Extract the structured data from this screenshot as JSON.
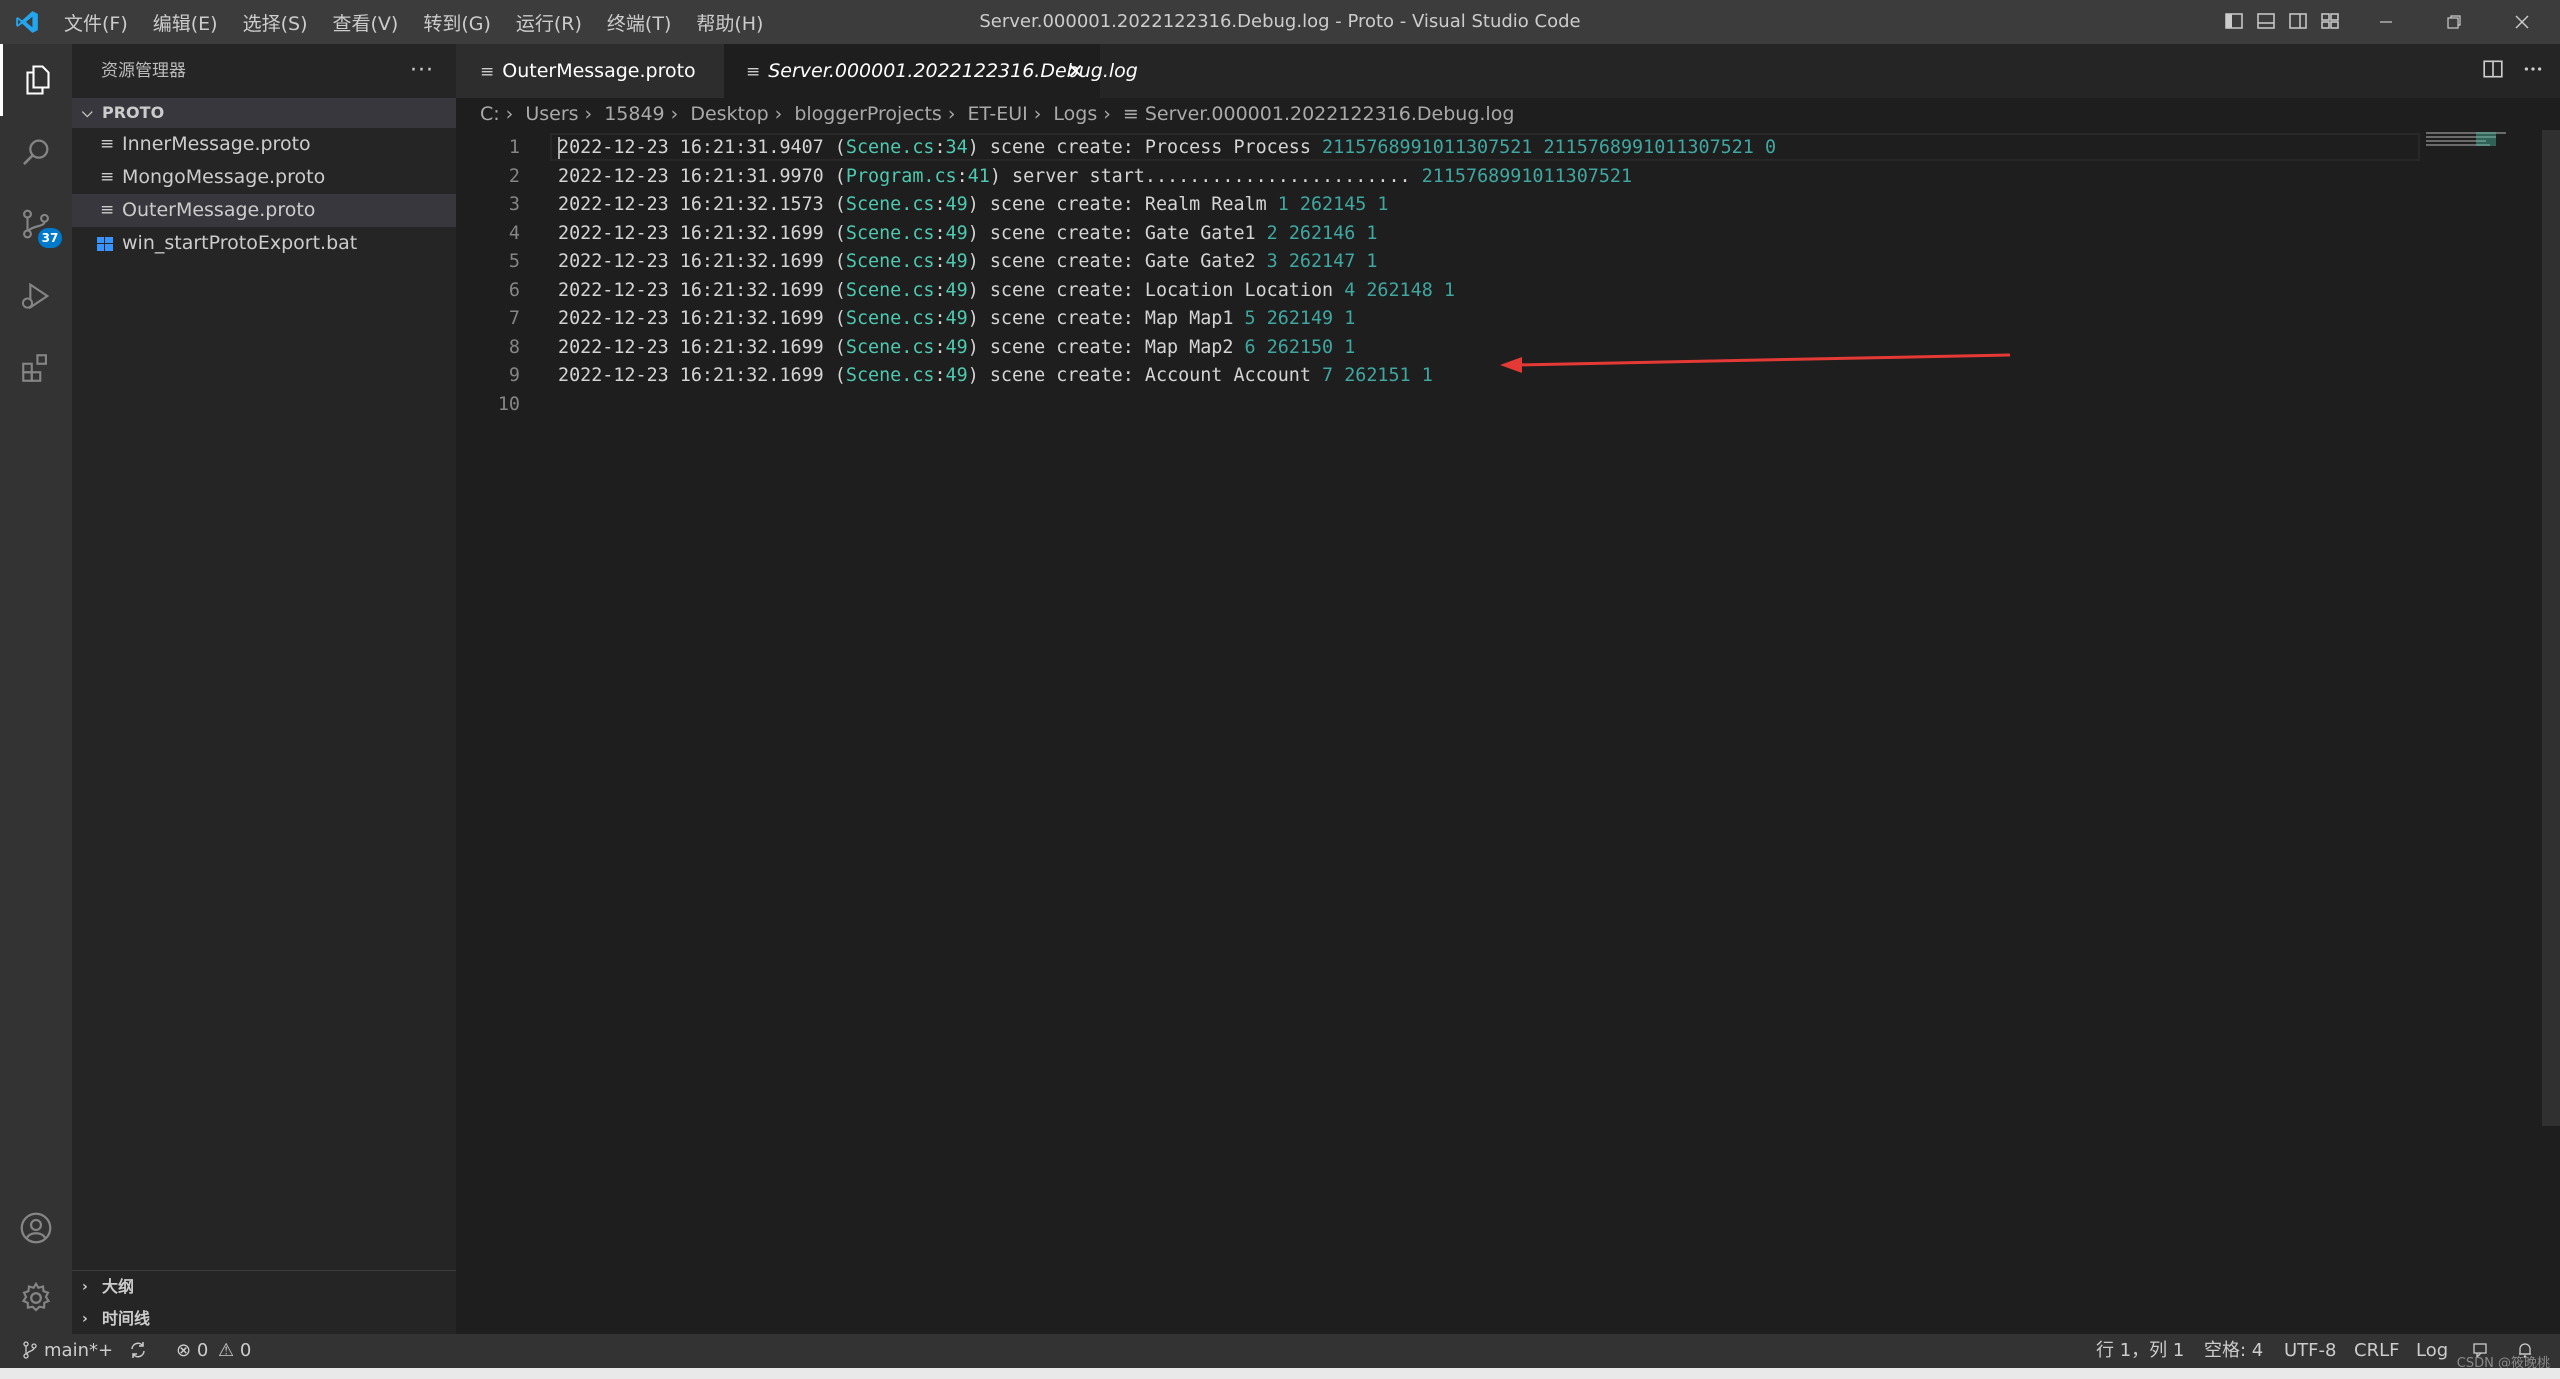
{
  "window": {
    "title": "Server.000001.2022122316.Debug.log - Proto - Visual Studio Code",
    "menu": [
      "文件(F)",
      "编辑(E)",
      "选择(S)",
      "查看(V)",
      "转到(G)",
      "运行(R)",
      "终端(T)",
      "帮助(H)"
    ]
  },
  "activity": {
    "scm_badge": "37"
  },
  "sidebar": {
    "title": "资源管理器",
    "more": "···",
    "folder": "PROTO",
    "files": [
      {
        "name": "InnerMessage.proto"
      },
      {
        "name": "MongoMessage.proto"
      },
      {
        "name": "OuterMessage.proto"
      },
      {
        "name": "win_startProtoExport.bat"
      }
    ],
    "outline": "大纲",
    "timeline": "时间线"
  },
  "tabs": [
    {
      "label": "OuterMessage.proto"
    },
    {
      "label": "Server.000001.2022122316.Debug.log"
    }
  ],
  "breadcrumb": [
    "C:",
    "Users",
    "15849",
    "Desktop",
    "bloggerProjects",
    "ET-EUI",
    "Logs",
    "Server.000001.2022122316.Debug.log"
  ],
  "editor": {
    "lines": [
      {
        "n": "1",
        "ts": "2022-12-23 16:21:31.9407",
        "file": "Scene.cs",
        "ln": "34",
        "msg": "scene create: Process Process",
        "a": "2115768991011307521",
        "b": "2115768991011307521",
        "c": "0"
      },
      {
        "n": "2",
        "ts": "2022-12-23 16:21:31.9970",
        "file": "Program.cs",
        "ln": "41",
        "msg": "server start........................",
        "a": "2115768991011307521",
        "b": "",
        "c": ""
      },
      {
        "n": "3",
        "ts": "2022-12-23 16:21:32.1573",
        "file": "Scene.cs",
        "ln": "49",
        "msg": "scene create: Realm Realm",
        "a": "1",
        "b": "262145",
        "c": "1"
      },
      {
        "n": "4",
        "ts": "2022-12-23 16:21:32.1699",
        "file": "Scene.cs",
        "ln": "49",
        "msg": "scene create: Gate Gate1",
        "a": "2",
        "b": "262146",
        "c": "1"
      },
      {
        "n": "5",
        "ts": "2022-12-23 16:21:32.1699",
        "file": "Scene.cs",
        "ln": "49",
        "msg": "scene create: Gate Gate2",
        "a": "3",
        "b": "262147",
        "c": "1"
      },
      {
        "n": "6",
        "ts": "2022-12-23 16:21:32.1699",
        "file": "Scene.cs",
        "ln": "49",
        "msg": "scene create: Location Location",
        "a": "4",
        "b": "262148",
        "c": "1"
      },
      {
        "n": "7",
        "ts": "2022-12-23 16:21:32.1699",
        "file": "Scene.cs",
        "ln": "49",
        "msg": "scene create: Map Map1",
        "a": "5",
        "b": "262149",
        "c": "1"
      },
      {
        "n": "8",
        "ts": "2022-12-23 16:21:32.1699",
        "file": "Scene.cs",
        "ln": "49",
        "msg": "scene create: Map Map2",
        "a": "6",
        "b": "262150",
        "c": "1"
      },
      {
        "n": "9",
        "ts": "2022-12-23 16:21:32.1699",
        "file": "Scene.cs",
        "ln": "49",
        "msg": "scene create: Account Account",
        "a": "7",
        "b": "262151",
        "c": "1"
      },
      {
        "n": "10",
        "ts": "",
        "file": "",
        "ln": "",
        "msg": "",
        "a": "",
        "b": "",
        "c": ""
      }
    ]
  },
  "status": {
    "branch": "main*+",
    "errors": "0",
    "warnings": "0",
    "position": "行 1，列 1",
    "indent": "空格: 4",
    "encoding": "UTF-8",
    "eol": "CRLF",
    "language": "Log",
    "watermark": "CSDN @筱晚桃"
  },
  "colors": {
    "titlebar": "#3c3c3c",
    "activitybar": "#333333",
    "sidebar": "#252526",
    "editor": "#1e1e1e",
    "teal_text": "#4ec9b0",
    "annotation_arrow": "#e53935"
  }
}
